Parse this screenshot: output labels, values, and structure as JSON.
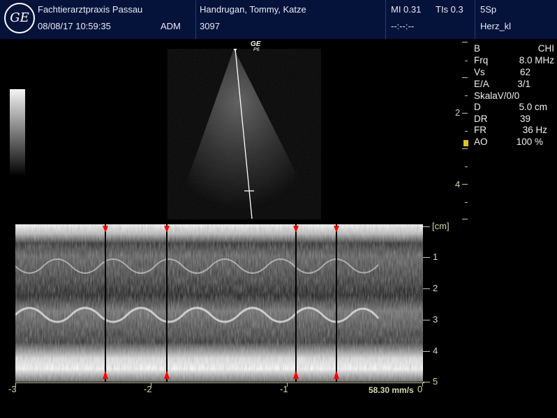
{
  "header": {
    "logo_text": "GE",
    "clinic": "Fachtierarztpraxis Passau",
    "datetime": "08/08/17 10:59:35",
    "operator": "ADM",
    "patient": "Handrugan, Tommy, Katze",
    "patient_id": "3097",
    "mi": "MI 0.31",
    "tis": "TIs 0.3",
    "time_placeholder": "--:--:--",
    "probe": "5Sp",
    "preset": "Herz_kl"
  },
  "probe_mark": {
    "brand": "GE",
    "sub": "P6"
  },
  "params": [
    {
      "label": "B",
      "value": "CHI"
    },
    {
      "label": "Frq",
      "value": "8.0 MHz"
    },
    {
      "label": "Vs",
      "value": "62"
    },
    {
      "label": "E/A",
      "value": "3/1"
    },
    {
      "label": "SkalaV/0/0",
      "value": ""
    },
    {
      "label": "D",
      "value": "5.0 cm"
    },
    {
      "label": "DR",
      "value": "39"
    },
    {
      "label": "FR",
      "value": "36 Hz"
    },
    {
      "label": "AO",
      "value": "100 %"
    }
  ],
  "bmode_depth_labels": [
    "2",
    "4"
  ],
  "mmode": {
    "unit": "[cm]",
    "depth_labels": [
      "1",
      "2",
      "3",
      "4",
      "5"
    ],
    "time_labels": [
      "-3",
      "-2",
      "-1",
      "0"
    ],
    "sweep_speed": "58.30 mm/s"
  },
  "colors": {
    "header_bg": "#05123a",
    "marker": "#ff0000",
    "scale": "#d8d8b0"
  }
}
